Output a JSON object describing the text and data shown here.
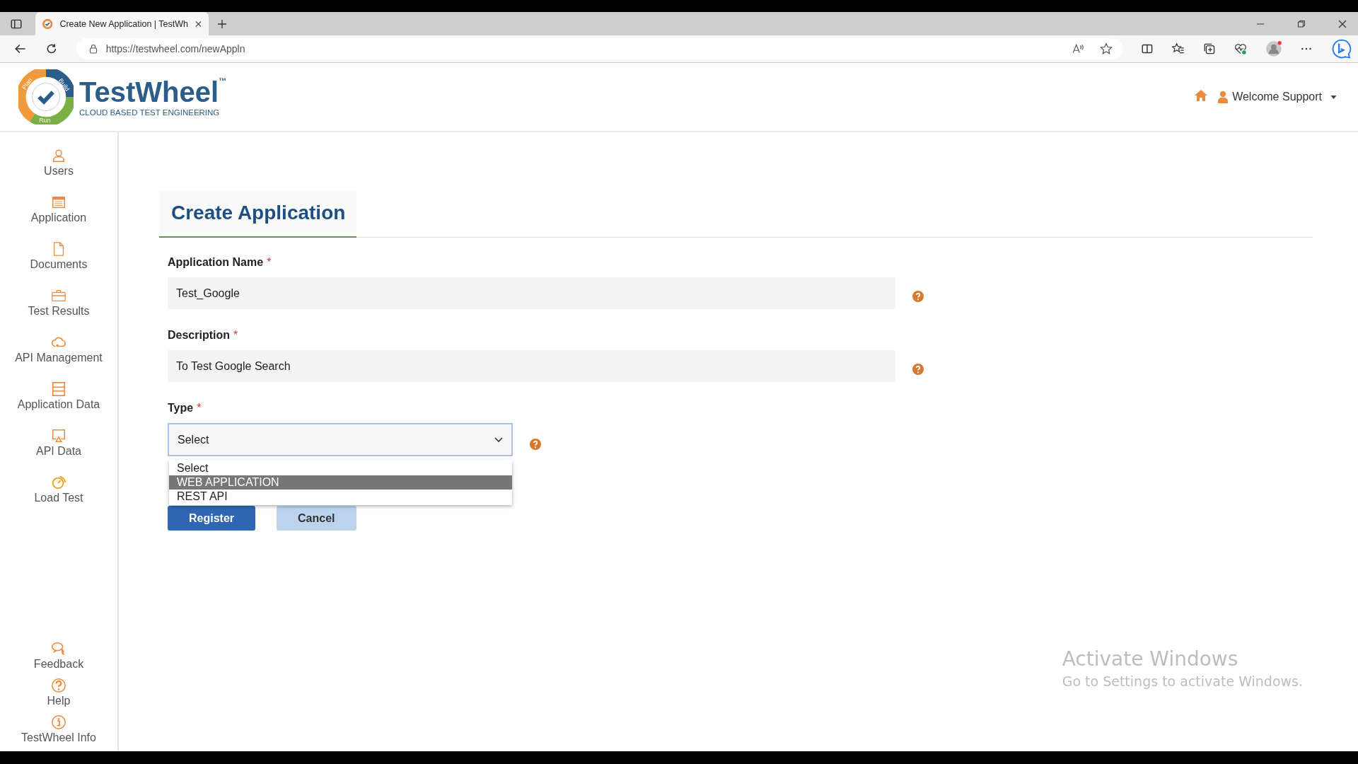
{
  "browser": {
    "tab_title": "Create New Application | TestWh",
    "url": "https://testwheel.com/newAppln"
  },
  "header": {
    "logo_name": "TestWheel",
    "logo_tm": "™",
    "logo_tagline": "CLOUD BASED TEST ENGINEERING",
    "logo_ring": [
      "Plan",
      "Build",
      "Run"
    ],
    "user_menu": "Welcome Support"
  },
  "sidebar": {
    "items": [
      {
        "label": "Users",
        "kind": "user"
      },
      {
        "label": "Application",
        "kind": "app"
      },
      {
        "label": "Documents",
        "kind": "doc"
      },
      {
        "label": "Test Results",
        "kind": "case"
      },
      {
        "label": "API Management",
        "kind": "cloud"
      },
      {
        "label": "Application Data",
        "kind": "server"
      },
      {
        "label": "API Data",
        "kind": "screen"
      },
      {
        "label": "Load Test",
        "kind": "gauge"
      }
    ],
    "bottom_items": [
      {
        "label": "Feedback",
        "kind": "chat"
      },
      {
        "label": "Help",
        "kind": "help"
      },
      {
        "label": "TestWheel Info",
        "kind": "info"
      }
    ]
  },
  "form": {
    "title": "Create Application",
    "required_mark": "*",
    "fields": [
      {
        "label": "Application Name",
        "value": "Test_Google"
      },
      {
        "label": "Description",
        "value": "To Test Google Search"
      }
    ],
    "type": {
      "label": "Type",
      "value": "Select",
      "expanded": true,
      "options": [
        {
          "label": "Select",
          "highlighted": false
        },
        {
          "label": "WEB APPLICATION",
          "highlighted": true
        },
        {
          "label": "REST API",
          "highlighted": false
        }
      ]
    },
    "buttons": [
      {
        "label": "Register",
        "kind": "primary"
      },
      {
        "label": "Cancel",
        "kind": "secondary"
      }
    ]
  },
  "watermark": {
    "title": "Activate Windows",
    "subtitle": "Go to Settings to activate Windows."
  }
}
